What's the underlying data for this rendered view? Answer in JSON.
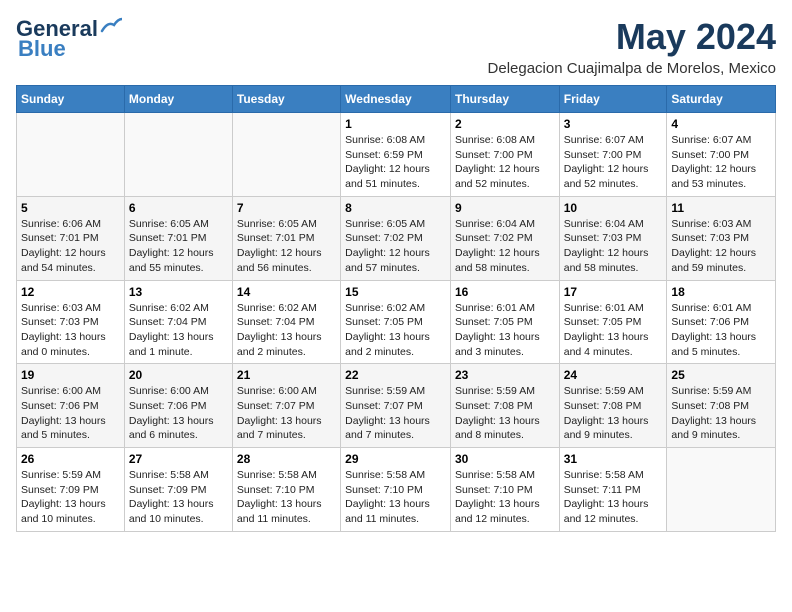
{
  "logo": {
    "line1": "General",
    "line2": "Blue"
  },
  "title": "May 2024",
  "location": "Delegacion Cuajimalpa de Morelos, Mexico",
  "headers": [
    "Sunday",
    "Monday",
    "Tuesday",
    "Wednesday",
    "Thursday",
    "Friday",
    "Saturday"
  ],
  "weeks": [
    [
      {
        "day": "",
        "content": ""
      },
      {
        "day": "",
        "content": ""
      },
      {
        "day": "",
        "content": ""
      },
      {
        "day": "1",
        "content": "Sunrise: 6:08 AM\nSunset: 6:59 PM\nDaylight: 12 hours\nand 51 minutes."
      },
      {
        "day": "2",
        "content": "Sunrise: 6:08 AM\nSunset: 7:00 PM\nDaylight: 12 hours\nand 52 minutes."
      },
      {
        "day": "3",
        "content": "Sunrise: 6:07 AM\nSunset: 7:00 PM\nDaylight: 12 hours\nand 52 minutes."
      },
      {
        "day": "4",
        "content": "Sunrise: 6:07 AM\nSunset: 7:00 PM\nDaylight: 12 hours\nand 53 minutes."
      }
    ],
    [
      {
        "day": "5",
        "content": "Sunrise: 6:06 AM\nSunset: 7:01 PM\nDaylight: 12 hours\nand 54 minutes."
      },
      {
        "day": "6",
        "content": "Sunrise: 6:05 AM\nSunset: 7:01 PM\nDaylight: 12 hours\nand 55 minutes."
      },
      {
        "day": "7",
        "content": "Sunrise: 6:05 AM\nSunset: 7:01 PM\nDaylight: 12 hours\nand 56 minutes."
      },
      {
        "day": "8",
        "content": "Sunrise: 6:05 AM\nSunset: 7:02 PM\nDaylight: 12 hours\nand 57 minutes."
      },
      {
        "day": "9",
        "content": "Sunrise: 6:04 AM\nSunset: 7:02 PM\nDaylight: 12 hours\nand 58 minutes."
      },
      {
        "day": "10",
        "content": "Sunrise: 6:04 AM\nSunset: 7:03 PM\nDaylight: 12 hours\nand 58 minutes."
      },
      {
        "day": "11",
        "content": "Sunrise: 6:03 AM\nSunset: 7:03 PM\nDaylight: 12 hours\nand 59 minutes."
      }
    ],
    [
      {
        "day": "12",
        "content": "Sunrise: 6:03 AM\nSunset: 7:03 PM\nDaylight: 13 hours\nand 0 minutes."
      },
      {
        "day": "13",
        "content": "Sunrise: 6:02 AM\nSunset: 7:04 PM\nDaylight: 13 hours\nand 1 minute."
      },
      {
        "day": "14",
        "content": "Sunrise: 6:02 AM\nSunset: 7:04 PM\nDaylight: 13 hours\nand 2 minutes."
      },
      {
        "day": "15",
        "content": "Sunrise: 6:02 AM\nSunset: 7:05 PM\nDaylight: 13 hours\nand 2 minutes."
      },
      {
        "day": "16",
        "content": "Sunrise: 6:01 AM\nSunset: 7:05 PM\nDaylight: 13 hours\nand 3 minutes."
      },
      {
        "day": "17",
        "content": "Sunrise: 6:01 AM\nSunset: 7:05 PM\nDaylight: 13 hours\nand 4 minutes."
      },
      {
        "day": "18",
        "content": "Sunrise: 6:01 AM\nSunset: 7:06 PM\nDaylight: 13 hours\nand 5 minutes."
      }
    ],
    [
      {
        "day": "19",
        "content": "Sunrise: 6:00 AM\nSunset: 7:06 PM\nDaylight: 13 hours\nand 5 minutes."
      },
      {
        "day": "20",
        "content": "Sunrise: 6:00 AM\nSunset: 7:06 PM\nDaylight: 13 hours\nand 6 minutes."
      },
      {
        "day": "21",
        "content": "Sunrise: 6:00 AM\nSunset: 7:07 PM\nDaylight: 13 hours\nand 7 minutes."
      },
      {
        "day": "22",
        "content": "Sunrise: 5:59 AM\nSunset: 7:07 PM\nDaylight: 13 hours\nand 7 minutes."
      },
      {
        "day": "23",
        "content": "Sunrise: 5:59 AM\nSunset: 7:08 PM\nDaylight: 13 hours\nand 8 minutes."
      },
      {
        "day": "24",
        "content": "Sunrise: 5:59 AM\nSunset: 7:08 PM\nDaylight: 13 hours\nand 9 minutes."
      },
      {
        "day": "25",
        "content": "Sunrise: 5:59 AM\nSunset: 7:08 PM\nDaylight: 13 hours\nand 9 minutes."
      }
    ],
    [
      {
        "day": "26",
        "content": "Sunrise: 5:59 AM\nSunset: 7:09 PM\nDaylight: 13 hours\nand 10 minutes."
      },
      {
        "day": "27",
        "content": "Sunrise: 5:58 AM\nSunset: 7:09 PM\nDaylight: 13 hours\nand 10 minutes."
      },
      {
        "day": "28",
        "content": "Sunrise: 5:58 AM\nSunset: 7:10 PM\nDaylight: 13 hours\nand 11 minutes."
      },
      {
        "day": "29",
        "content": "Sunrise: 5:58 AM\nSunset: 7:10 PM\nDaylight: 13 hours\nand 11 minutes."
      },
      {
        "day": "30",
        "content": "Sunrise: 5:58 AM\nSunset: 7:10 PM\nDaylight: 13 hours\nand 12 minutes."
      },
      {
        "day": "31",
        "content": "Sunrise: 5:58 AM\nSunset: 7:11 PM\nDaylight: 13 hours\nand 12 minutes."
      },
      {
        "day": "",
        "content": ""
      }
    ]
  ]
}
